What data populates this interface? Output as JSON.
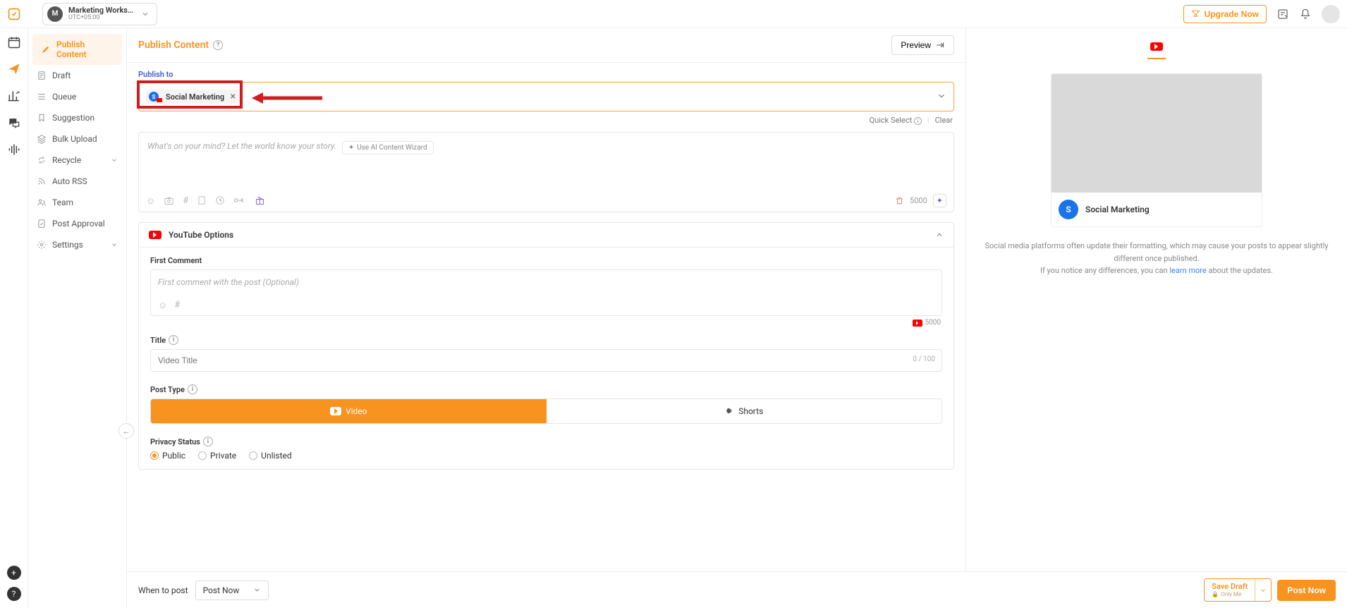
{
  "workspace": {
    "avatar_letter": "M",
    "name": "Marketing Workspa...",
    "timezone": "UTC+05:00"
  },
  "top": {
    "upgrade": "Upgrade Now"
  },
  "sidebar": {
    "items": [
      {
        "label": "Publish Content"
      },
      {
        "label": "Draft"
      },
      {
        "label": "Queue"
      },
      {
        "label": "Suggestion"
      },
      {
        "label": "Bulk Upload"
      },
      {
        "label": "Recycle"
      },
      {
        "label": "Auto RSS"
      },
      {
        "label": "Team"
      },
      {
        "label": "Post Approval"
      },
      {
        "label": "Settings"
      }
    ]
  },
  "header": {
    "title": "Publish Content",
    "preview": "Preview"
  },
  "publish_to": {
    "label": "Publish to",
    "chip": {
      "name": "Social Marketing",
      "avatar_letter": "S"
    }
  },
  "quick": {
    "quick_select": "Quick Select",
    "clear": "Clear"
  },
  "compose": {
    "placeholder": "What's on your mind? Let the world know your story.",
    "ai_btn": "Use AI Content Wizard",
    "counter": "5000"
  },
  "youtube": {
    "header": "YouTube Options",
    "first_comment": {
      "label": "First Comment",
      "placeholder": "First comment with the post (Optional)",
      "counter": "5000"
    },
    "title": {
      "label": "Title",
      "placeholder": "Video Title",
      "counter": "0 / 100"
    },
    "post_type": {
      "label": "Post Type",
      "video": "Video",
      "shorts": "Shorts"
    },
    "privacy": {
      "label": "Privacy Status",
      "public": "Public",
      "private": "Private",
      "unlisted": "Unlisted"
    }
  },
  "footer": {
    "when_label": "When to post",
    "when_value": "Post Now",
    "save_draft": "Save Draft",
    "only_me": "Only Me",
    "post_now": "Post Now"
  },
  "preview": {
    "account_name": "Social Marketing",
    "avatar_letter": "S",
    "notice1": "Social media platforms often update their formatting, which may cause your posts to appear slightly different once published.",
    "notice2a": "If you notice any differences, you can ",
    "notice2_link": "learn more",
    "notice2b": " about the updates."
  }
}
